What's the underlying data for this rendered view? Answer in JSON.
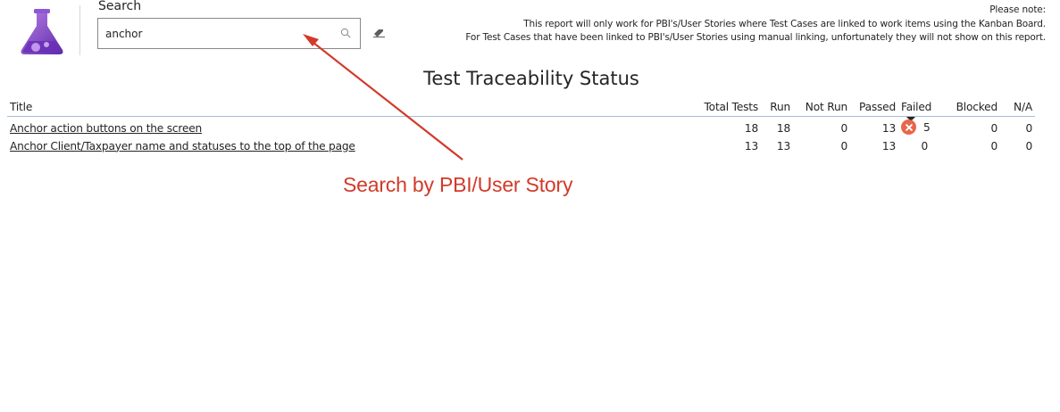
{
  "header": {
    "logo_icon": "flask-icon",
    "search": {
      "label": "Search",
      "value": "anchor",
      "placeholder": "",
      "search_icon": "search-icon",
      "clear_icon": "eraser-icon"
    },
    "note": {
      "line1": "Please note:",
      "line2": "This report will only work for PBI's/User Stories where Test Cases are linked to work items using the Kanban Board.",
      "line3": "For Test Cases that have been linked to PBI's/User Stories using manual linking, unfortunately they will not show on this report."
    }
  },
  "report": {
    "title": "Test Traceability Status",
    "columns": [
      "Title",
      "Total Tests",
      "Run",
      "Not Run",
      "Passed",
      "Failed",
      "Blocked",
      "N/A"
    ],
    "sorted_column": "Failed",
    "rows": [
      {
        "title": "Anchor action buttons on the screen",
        "total": "18",
        "run": "18",
        "not_run": "0",
        "passed": "13",
        "failed": "5",
        "blocked": "0",
        "na": "0",
        "failed_icon": "x-circle-icon"
      },
      {
        "title": "Anchor Client/Taxpayer name and statuses to the top of the page",
        "total": "13",
        "run": "13",
        "not_run": "0",
        "passed": "13",
        "failed": "0",
        "blocked": "0",
        "na": "0"
      }
    ]
  },
  "annotation": {
    "text": "Search by PBI/User Story",
    "color": "#d23a2a"
  },
  "colors": {
    "accent_purple": "#7b3fc4",
    "failed_icon": "#e8664a",
    "header_rule": "#a7bdd3"
  }
}
